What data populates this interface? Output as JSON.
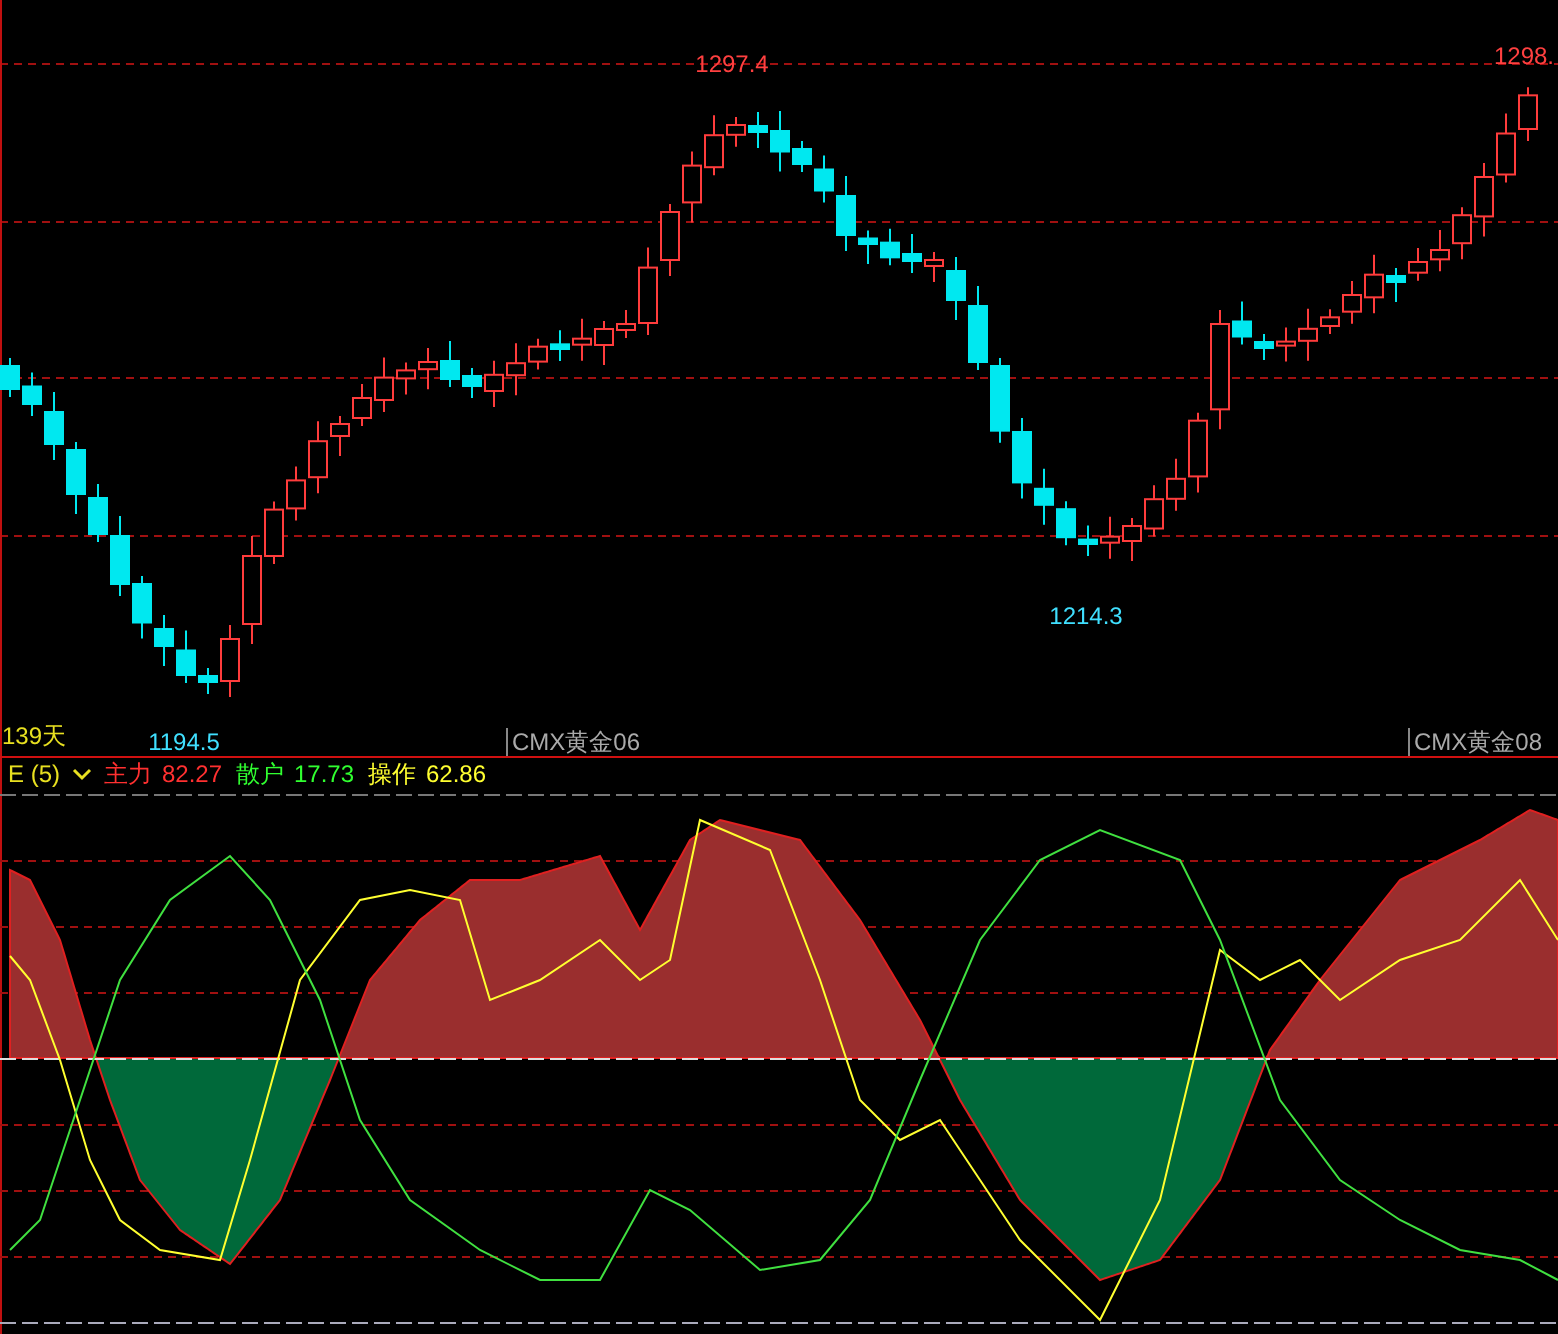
{
  "price_chart": {
    "period": "139天",
    "price_labels": [
      {
        "text": "1297.4",
        "color": "#ff4040"
      },
      {
        "text": "1194.5",
        "color": "#40e0ff"
      },
      {
        "text": "1214.3",
        "color": "#40e0ff"
      },
      {
        "text": "1298.",
        "color": "#ff4040"
      }
    ],
    "contract_labels": [
      "CMX黄金06",
      "CMX黄金08"
    ]
  },
  "indicator": {
    "name": "E (5)",
    "legend": [
      {
        "label": "主力",
        "value": "82.27",
        "color": "#ff3030"
      },
      {
        "label": "散户",
        "value": "17.73",
        "color": "#30ff30"
      },
      {
        "label": "操作",
        "value": "62.86",
        "color": "#ffff30"
      }
    ]
  }
}
